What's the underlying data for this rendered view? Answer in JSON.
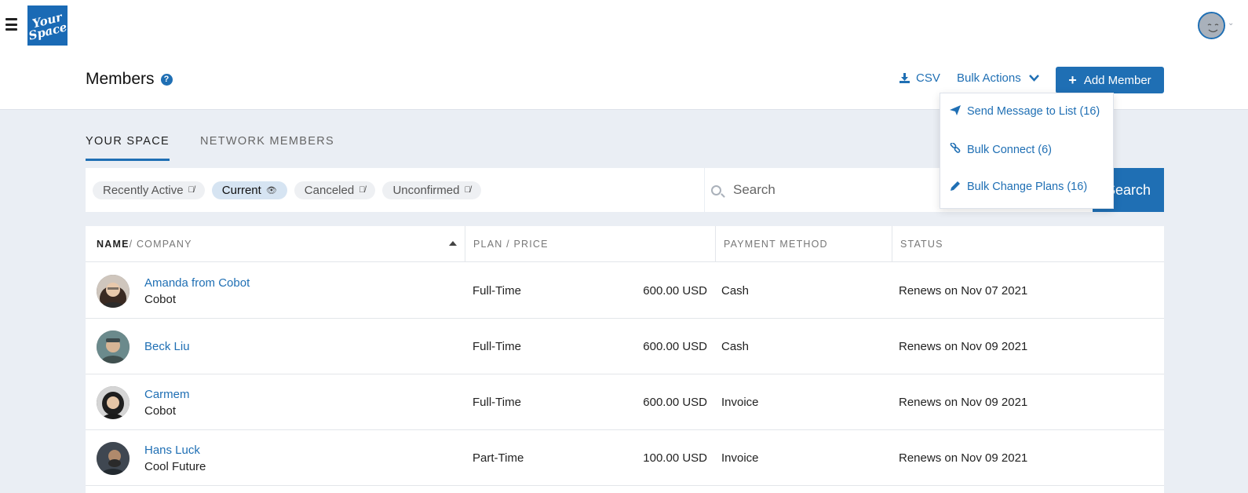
{
  "header": {
    "logo_line1": "Your",
    "logo_line2": "Space",
    "page_title": "Members",
    "csv_label": "CSV",
    "bulk_actions_label": "Bulk Actions",
    "add_member_label": "Add Member"
  },
  "tabs": [
    {
      "label": "YOUR SPACE",
      "active": true
    },
    {
      "label": "NETWORK MEMBERS",
      "active": false
    }
  ],
  "filters": [
    {
      "label": "Recently Active",
      "active": false
    },
    {
      "label": "Current",
      "active": true
    },
    {
      "label": "Canceled",
      "active": false
    },
    {
      "label": "Unconfirmed",
      "active": false
    }
  ],
  "search": {
    "placeholder": "Search",
    "button_label": "Search"
  },
  "bulk_menu": {
    "items": [
      {
        "label": "Send Message to List (16)",
        "icon": "paper-plane-icon"
      },
      {
        "label": "Bulk Connect (6)",
        "icon": "link-icon"
      },
      {
        "label": "Bulk Change Plans (16)",
        "icon": "pencil-icon"
      }
    ]
  },
  "table": {
    "columns": {
      "name": "NAME",
      "company": " / COMPANY",
      "plan_price": "PLAN / PRICE",
      "payment": "PAYMENT METHOD",
      "status": "STATUS"
    },
    "rows": [
      {
        "name": "Amanda from Cobot",
        "company": "Cobot",
        "plan": "Full-Time",
        "price": "600.00 USD",
        "payment": "Cash",
        "status": "Renews on Nov 07 2021"
      },
      {
        "name": "Beck Liu",
        "company": "",
        "plan": "Full-Time",
        "price": "600.00 USD",
        "payment": "Cash",
        "status": "Renews on Nov 09 2021"
      },
      {
        "name": "Carmem",
        "company": "Cobot",
        "plan": "Full-Time",
        "price": "600.00 USD",
        "payment": "Invoice",
        "status": "Renews on Nov 09 2021"
      },
      {
        "name": "Hans Luck",
        "company": "Cool Future",
        "plan": "Part-Time",
        "price": "100.00 USD",
        "payment": "Invoice",
        "status": "Renews on Nov 09 2021"
      }
    ]
  },
  "colors": {
    "accent": "#1f6fb4",
    "page_bg": "#eaeef4"
  }
}
